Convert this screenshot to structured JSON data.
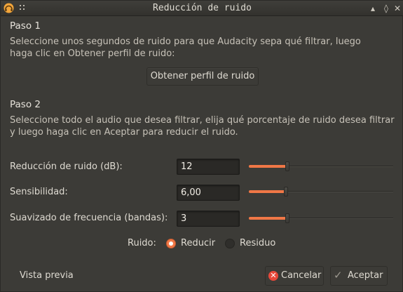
{
  "window": {
    "title": "Reducción de ruido",
    "app_icon": "audacity-icon",
    "controls": [
      "minimize-icon",
      "maximize-icon",
      "close-icon"
    ]
  },
  "step1": {
    "heading": "Paso 1",
    "line1": "Seleccione unos segundos de ruido para que Audacity sepa qué filtrar, luego",
    "line2": "haga clic en Obtener perfil de ruido:",
    "button": "Obtener perfil de ruido"
  },
  "step2": {
    "heading": "Paso 2",
    "line1": "Seleccione todo el audio que desea filtrar, elija qué porcentaje de ruido desea filtrar",
    "line2": "y luego haga clic en Aceptar para reducir el ruido."
  },
  "params": [
    {
      "label": "Reducción de ruido (dB):",
      "value": "12",
      "level": 0.26
    },
    {
      "label": "Sensibilidad:",
      "value": "6,00",
      "level": 0.25
    },
    {
      "label": "Suavizado de frecuencia (bandas):",
      "value": "3",
      "level": 0.26
    }
  ],
  "noise": {
    "label": "Ruido:",
    "options": [
      {
        "label": "Reducir",
        "selected": true
      },
      {
        "label": "Residuo",
        "selected": false
      }
    ]
  },
  "buttons": {
    "preview": "Vista previa",
    "cancel": "Cancelar",
    "ok": "Aceptar"
  },
  "colors": {
    "accent": "#f07746",
    "background": "#3c3b37",
    "cancel_icon": "#e8483a"
  }
}
